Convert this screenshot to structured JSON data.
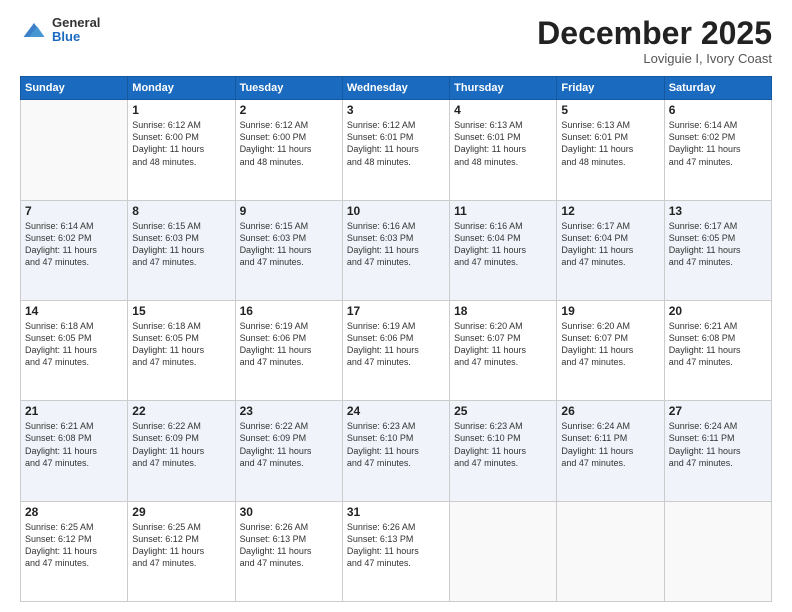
{
  "logo": {
    "general": "General",
    "blue": "Blue"
  },
  "header": {
    "month": "December 2025",
    "location": "Loviguie I, Ivory Coast"
  },
  "weekdays": [
    "Sunday",
    "Monday",
    "Tuesday",
    "Wednesday",
    "Thursday",
    "Friday",
    "Saturday"
  ],
  "weeks": [
    [
      {
        "day": "",
        "sunrise": "",
        "sunset": "",
        "daylight": ""
      },
      {
        "day": "1",
        "sunrise": "Sunrise: 6:12 AM",
        "sunset": "Sunset: 6:00 PM",
        "daylight": "Daylight: 11 hours and 48 minutes."
      },
      {
        "day": "2",
        "sunrise": "Sunrise: 6:12 AM",
        "sunset": "Sunset: 6:00 PM",
        "daylight": "Daylight: 11 hours and 48 minutes."
      },
      {
        "day": "3",
        "sunrise": "Sunrise: 6:12 AM",
        "sunset": "Sunset: 6:01 PM",
        "daylight": "Daylight: 11 hours and 48 minutes."
      },
      {
        "day": "4",
        "sunrise": "Sunrise: 6:13 AM",
        "sunset": "Sunset: 6:01 PM",
        "daylight": "Daylight: 11 hours and 48 minutes."
      },
      {
        "day": "5",
        "sunrise": "Sunrise: 6:13 AM",
        "sunset": "Sunset: 6:01 PM",
        "daylight": "Daylight: 11 hours and 48 minutes."
      },
      {
        "day": "6",
        "sunrise": "Sunrise: 6:14 AM",
        "sunset": "Sunset: 6:02 PM",
        "daylight": "Daylight: 11 hours and 47 minutes."
      }
    ],
    [
      {
        "day": "7",
        "sunrise": "Sunrise: 6:14 AM",
        "sunset": "Sunset: 6:02 PM",
        "daylight": "Daylight: 11 hours and 47 minutes."
      },
      {
        "day": "8",
        "sunrise": "Sunrise: 6:15 AM",
        "sunset": "Sunset: 6:03 PM",
        "daylight": "Daylight: 11 hours and 47 minutes."
      },
      {
        "day": "9",
        "sunrise": "Sunrise: 6:15 AM",
        "sunset": "Sunset: 6:03 PM",
        "daylight": "Daylight: 11 hours and 47 minutes."
      },
      {
        "day": "10",
        "sunrise": "Sunrise: 6:16 AM",
        "sunset": "Sunset: 6:03 PM",
        "daylight": "Daylight: 11 hours and 47 minutes."
      },
      {
        "day": "11",
        "sunrise": "Sunrise: 6:16 AM",
        "sunset": "Sunset: 6:04 PM",
        "daylight": "Daylight: 11 hours and 47 minutes."
      },
      {
        "day": "12",
        "sunrise": "Sunrise: 6:17 AM",
        "sunset": "Sunset: 6:04 PM",
        "daylight": "Daylight: 11 hours and 47 minutes."
      },
      {
        "day": "13",
        "sunrise": "Sunrise: 6:17 AM",
        "sunset": "Sunset: 6:05 PM",
        "daylight": "Daylight: 11 hours and 47 minutes."
      }
    ],
    [
      {
        "day": "14",
        "sunrise": "Sunrise: 6:18 AM",
        "sunset": "Sunset: 6:05 PM",
        "daylight": "Daylight: 11 hours and 47 minutes."
      },
      {
        "day": "15",
        "sunrise": "Sunrise: 6:18 AM",
        "sunset": "Sunset: 6:05 PM",
        "daylight": "Daylight: 11 hours and 47 minutes."
      },
      {
        "day": "16",
        "sunrise": "Sunrise: 6:19 AM",
        "sunset": "Sunset: 6:06 PM",
        "daylight": "Daylight: 11 hours and 47 minutes."
      },
      {
        "day": "17",
        "sunrise": "Sunrise: 6:19 AM",
        "sunset": "Sunset: 6:06 PM",
        "daylight": "Daylight: 11 hours and 47 minutes."
      },
      {
        "day": "18",
        "sunrise": "Sunrise: 6:20 AM",
        "sunset": "Sunset: 6:07 PM",
        "daylight": "Daylight: 11 hours and 47 minutes."
      },
      {
        "day": "19",
        "sunrise": "Sunrise: 6:20 AM",
        "sunset": "Sunset: 6:07 PM",
        "daylight": "Daylight: 11 hours and 47 minutes."
      },
      {
        "day": "20",
        "sunrise": "Sunrise: 6:21 AM",
        "sunset": "Sunset: 6:08 PM",
        "daylight": "Daylight: 11 hours and 47 minutes."
      }
    ],
    [
      {
        "day": "21",
        "sunrise": "Sunrise: 6:21 AM",
        "sunset": "Sunset: 6:08 PM",
        "daylight": "Daylight: 11 hours and 47 minutes."
      },
      {
        "day": "22",
        "sunrise": "Sunrise: 6:22 AM",
        "sunset": "Sunset: 6:09 PM",
        "daylight": "Daylight: 11 hours and 47 minutes."
      },
      {
        "day": "23",
        "sunrise": "Sunrise: 6:22 AM",
        "sunset": "Sunset: 6:09 PM",
        "daylight": "Daylight: 11 hours and 47 minutes."
      },
      {
        "day": "24",
        "sunrise": "Sunrise: 6:23 AM",
        "sunset": "Sunset: 6:10 PM",
        "daylight": "Daylight: 11 hours and 47 minutes."
      },
      {
        "day": "25",
        "sunrise": "Sunrise: 6:23 AM",
        "sunset": "Sunset: 6:10 PM",
        "daylight": "Daylight: 11 hours and 47 minutes."
      },
      {
        "day": "26",
        "sunrise": "Sunrise: 6:24 AM",
        "sunset": "Sunset: 6:11 PM",
        "daylight": "Daylight: 11 hours and 47 minutes."
      },
      {
        "day": "27",
        "sunrise": "Sunrise: 6:24 AM",
        "sunset": "Sunset: 6:11 PM",
        "daylight": "Daylight: 11 hours and 47 minutes."
      }
    ],
    [
      {
        "day": "28",
        "sunrise": "Sunrise: 6:25 AM",
        "sunset": "Sunset: 6:12 PM",
        "daylight": "Daylight: 11 hours and 47 minutes."
      },
      {
        "day": "29",
        "sunrise": "Sunrise: 6:25 AM",
        "sunset": "Sunset: 6:12 PM",
        "daylight": "Daylight: 11 hours and 47 minutes."
      },
      {
        "day": "30",
        "sunrise": "Sunrise: 6:26 AM",
        "sunset": "Sunset: 6:13 PM",
        "daylight": "Daylight: 11 hours and 47 minutes."
      },
      {
        "day": "31",
        "sunrise": "Sunrise: 6:26 AM",
        "sunset": "Sunset: 6:13 PM",
        "daylight": "Daylight: 11 hours and 47 minutes."
      },
      {
        "day": "",
        "sunrise": "",
        "sunset": "",
        "daylight": ""
      },
      {
        "day": "",
        "sunrise": "",
        "sunset": "",
        "daylight": ""
      },
      {
        "day": "",
        "sunrise": "",
        "sunset": "",
        "daylight": ""
      }
    ]
  ]
}
